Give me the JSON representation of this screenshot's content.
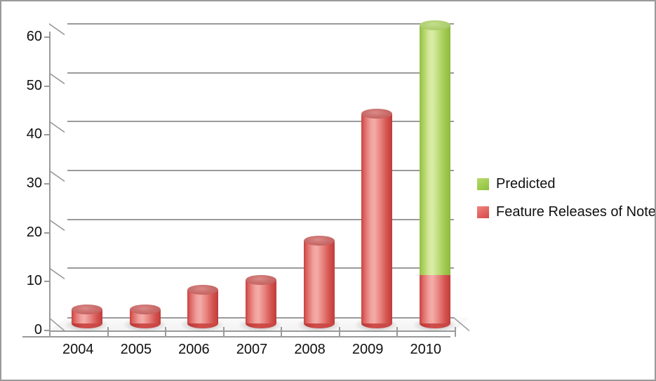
{
  "chart_data": {
    "type": "bar",
    "subtype": "stacked-3d-cylinder",
    "title": "",
    "xlabel": "",
    "ylabel": "",
    "categories": [
      "2004",
      "2005",
      "2006",
      "2007",
      "2008",
      "2009",
      "2010"
    ],
    "series": [
      {
        "name": "Feature Releases of Note",
        "color": "#e2605c",
        "values": [
          3,
          3,
          7,
          9,
          17,
          43,
          10
        ]
      },
      {
        "name": "Predicted",
        "color": "#9ecb4d",
        "values": [
          0,
          0,
          0,
          0,
          0,
          0,
          51
        ]
      }
    ],
    "stack_totals": [
      3,
      3,
      7,
      9,
      17,
      43,
      61
    ],
    "ylim": [
      0,
      63
    ],
    "y_ticks": [
      "0",
      "10",
      "20",
      "30",
      "40",
      "50",
      "60"
    ],
    "y_tick_values": [
      0,
      10,
      20,
      30,
      40,
      50,
      60
    ],
    "grid": true,
    "grid_axis": "y",
    "legend_position": "right",
    "legend": [
      {
        "label": "Predicted",
        "swatch": "sw-green"
      },
      {
        "label": "Feature Releases of Note",
        "swatch": "sw-red"
      }
    ]
  }
}
